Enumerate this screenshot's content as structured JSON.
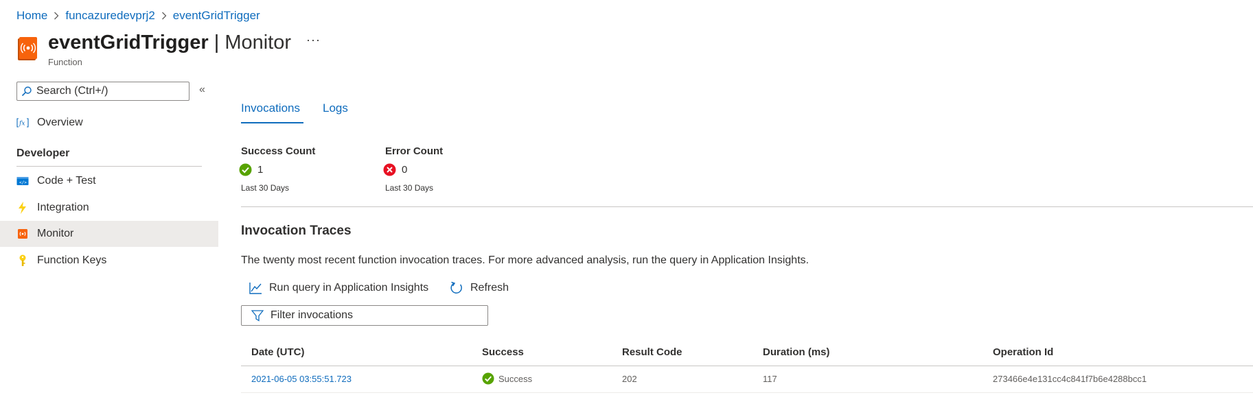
{
  "breadcrumb": [
    "Home",
    "funcazuredevprj2",
    "eventGridTrigger"
  ],
  "header": {
    "title_bold": "eventGridTrigger",
    "title_sep": " | ",
    "title_rest": "Monitor",
    "more": "···",
    "subtitle": "Function"
  },
  "sidebar": {
    "search_placeholder": "Search (Ctrl+/)",
    "collapse": "«",
    "overview": "Overview",
    "section": "Developer",
    "items": [
      "Code + Test",
      "Integration",
      "Monitor",
      "Function Keys"
    ],
    "selected": "Monitor"
  },
  "tabs": [
    "Invocations",
    "Logs"
  ],
  "stats": {
    "success": {
      "label": "Success Count",
      "value": "1",
      "sub": "Last 30 Days"
    },
    "error": {
      "label": "Error Count",
      "value": "0",
      "sub": "Last 30 Days"
    }
  },
  "traces": {
    "title": "Invocation Traces",
    "description": "The twenty most recent function invocation traces. For more advanced analysis, run the query in Application Insights.",
    "run_query": "Run query in Application Insights",
    "refresh": "Refresh",
    "filter_placeholder": "Filter invocations",
    "columns": [
      "Date (UTC)",
      "Success",
      "Result Code",
      "Duration (ms)",
      "Operation Id"
    ],
    "rows": [
      {
        "date": "2021-06-05 03:55:51.723",
        "success": "Success",
        "result_code": "202",
        "duration": "117",
        "operation_id": "273466e4e131cc4c841f7b6e4288bcc1"
      }
    ]
  },
  "colors": {
    "accent": "#0f6cbd",
    "success": "#57a300",
    "error": "#e81123",
    "function_orange": "#f7630c",
    "selected_bg": "#edebe9"
  }
}
